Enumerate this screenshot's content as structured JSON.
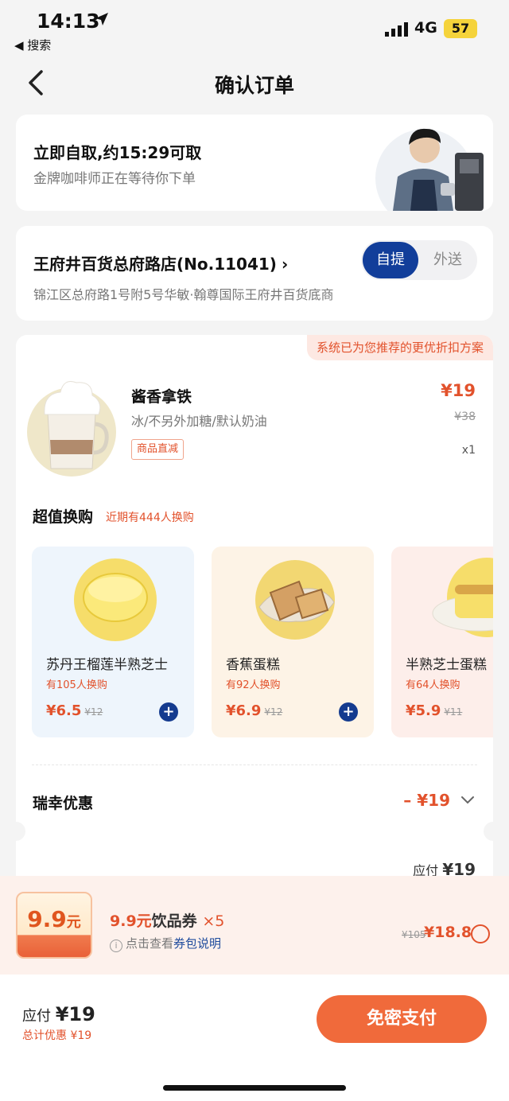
{
  "status": {
    "time": "14:13",
    "back_app": "◀ 搜索",
    "network": "4G",
    "battery": "57"
  },
  "nav": {
    "title": "确认订单"
  },
  "pickup": {
    "title": "立即自取,约15:29可取",
    "subtitle": "金牌咖啡师正在等待你下单"
  },
  "store": {
    "name": "王府井百货总府路店(No.11041)",
    "chevron": "›",
    "address": "锦江区总府路1号附5号华敏·翰尊国际王府井百货底商",
    "toggle": {
      "pickup": "自提",
      "delivery": "外送",
      "selected": "自提"
    }
  },
  "order": {
    "banner": "系统已为您推荐的更优折扣方案",
    "product": {
      "name": "酱香拿铁",
      "spec": "冰/不另外加糖/默认奶油",
      "tag": "商品直减",
      "price": "¥19",
      "original": "¥38",
      "qty": "x1"
    },
    "addon_title": "超值换购",
    "addon_sub": "近期有444人换购",
    "addons": [
      {
        "name": "苏丹王榴莲半熟芝士",
        "count": "有105人换购",
        "price": "¥6.5",
        "original": "¥12",
        "bg": "#eef5fc"
      },
      {
        "name": "香蕉蛋糕",
        "count": "有92人换购",
        "price": "¥6.9",
        "original": "¥12",
        "bg": "#fdf3e6"
      },
      {
        "name": "半熟芝士蛋糕",
        "count": "有64人换购",
        "price": "¥5.9",
        "original": "¥11",
        "bg": "#fdeeea"
      }
    ],
    "discount": {
      "label": "瑞幸优惠",
      "value": "– ¥19"
    },
    "due": {
      "label": "应付",
      "value": "¥19"
    }
  },
  "coupon": {
    "badge_value": "9.9",
    "badge_unit": "元",
    "title_highlight": "9.9元",
    "title_text": "饮品券",
    "title_count": "×5",
    "info_prefix": "点击查看",
    "info_link": "券包说明",
    "original": "¥105",
    "price": "¥18.8"
  },
  "footer": {
    "pay_label": "应付",
    "pay_value": "¥19",
    "total_discount": "总计优惠 ¥19",
    "pay_button": "免密支付"
  },
  "colors": {
    "accent": "#e2522c",
    "brand_blue": "#123e9a",
    "pay_button": "#f06a3b"
  }
}
